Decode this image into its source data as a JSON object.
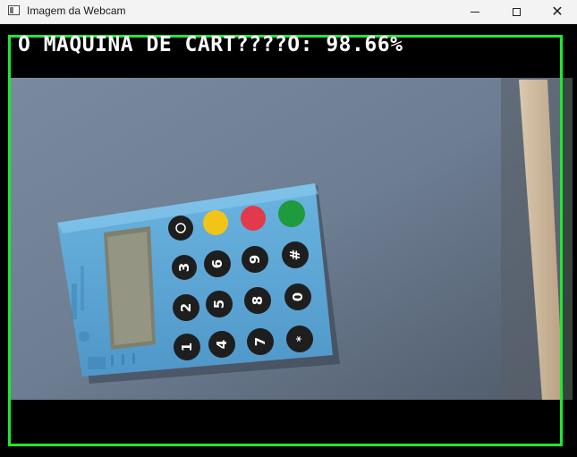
{
  "window": {
    "title": "Imagem da Webcam",
    "controls": {
      "minimize_icon": "minimize-icon",
      "maximize_icon": "maximize-icon",
      "close_icon": "close-icon",
      "close_glyph": "✕"
    }
  },
  "detection": {
    "label": "O MAQUINA DE CART????O: 98.66%",
    "box_color": "#1ee832",
    "text_color": "#ffffff"
  },
  "keypad": {
    "keys": [
      "1",
      "2",
      "3",
      "4",
      "5",
      "6",
      "7",
      "8",
      "9",
      "0",
      "#"
    ]
  }
}
